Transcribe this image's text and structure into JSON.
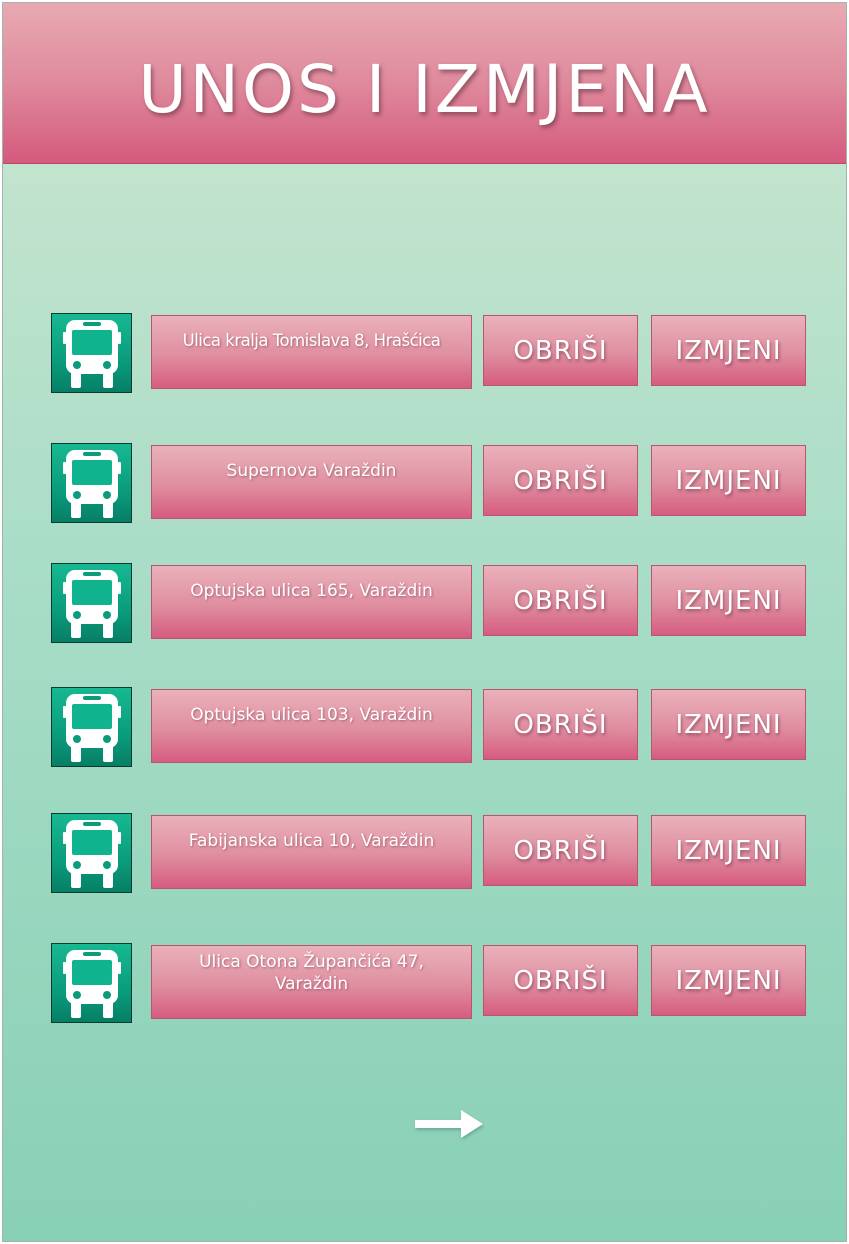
{
  "header": {
    "title": "UNOS I IZMJENA"
  },
  "colors": {
    "header_pink": "#d45a7d",
    "background_green": "#88d0b6",
    "bus_icon_green": "#0a9c7c"
  },
  "rows": [
    {
      "address": "Ulica kralja Tomislava 8, Hrašćica",
      "delete_label": "OBRIŠI",
      "edit_label": "IZMJENI",
      "icon": "bus-icon"
    },
    {
      "address": "Supernova Varaždin",
      "delete_label": "OBRIŠI",
      "edit_label": "IZMJENI",
      "icon": "bus-icon"
    },
    {
      "address": "Optujska ulica 165, Varaždin",
      "delete_label": "OBRIŠI",
      "edit_label": "IZMJENI",
      "icon": "bus-icon"
    },
    {
      "address": "Optujska ulica 103, Varaždin",
      "delete_label": "OBRIŠI",
      "edit_label": "IZMJENI",
      "icon": "bus-icon"
    },
    {
      "address": "Fabijanska ulica 10, Varaždin",
      "delete_label": "OBRIŠI",
      "edit_label": "IZMJENI",
      "icon": "bus-icon"
    },
    {
      "address": "Ulica Otona Župančića 47, Varaždin",
      "delete_label": "OBRIŠI",
      "edit_label": "IZMJENI",
      "icon": "bus-icon"
    }
  ],
  "footer": {
    "next_icon": "arrow-right-icon"
  }
}
